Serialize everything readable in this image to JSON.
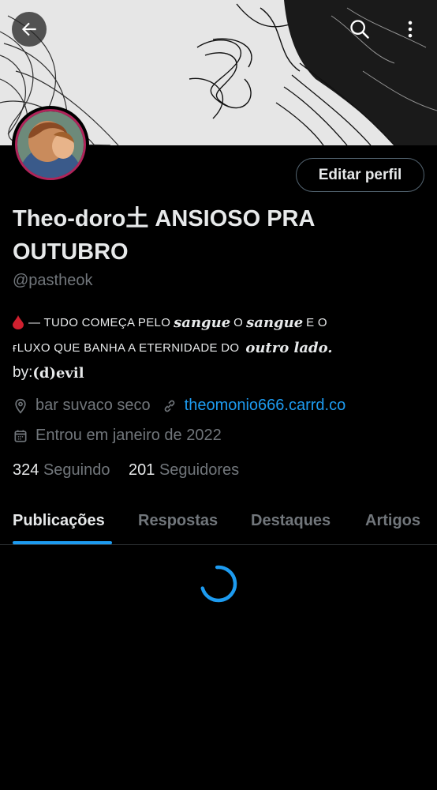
{
  "header": {
    "back_icon": "arrow-left-icon",
    "search_icon": "search-icon",
    "more_icon": "more-vertical-icon"
  },
  "profile": {
    "edit_label": "Editar perfil",
    "name_line1": "Theo-doro土 ANSIOSO PRA",
    "name_line2": "OUTUBRO",
    "handle": "@pastheok",
    "bio": {
      "line1_a": "— TUDO COMEÇA PELO",
      "line1_b": "sangue",
      "line1_c": "O",
      "line1_d": "sangue",
      "line1_e": "E O",
      "line2_a": "ғLUXO QUE BANHA A ETERNIDADE DO",
      "line2_b": "outro lado.",
      "line3_a": "by:",
      "line3_b": "(d)evil"
    },
    "location": "bar suvaco seco",
    "website": "theomonio666.carrd.co",
    "joined": "Entrou em janeiro de 2022",
    "following_count": "324",
    "following_label": "Seguindo",
    "followers_count": "201",
    "followers_label": "Seguidores"
  },
  "tabs": [
    {
      "label": "Publicações",
      "active": true
    },
    {
      "label": "Respostas",
      "active": false
    },
    {
      "label": "Destaques",
      "active": false
    },
    {
      "label": "Artigos",
      "active": false
    }
  ],
  "colors": {
    "accent": "#1d9bf0",
    "muted": "#71767b",
    "text": "#e7e9ea",
    "background": "#000000"
  }
}
